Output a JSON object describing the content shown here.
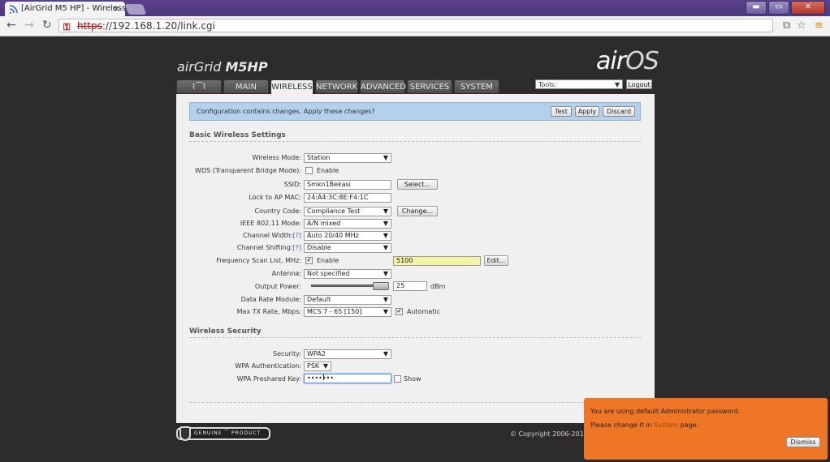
{
  "browser": {
    "tab_title": "[AirGrid M5 HP] - Wireless",
    "tab_close": "×",
    "url_scheme": "https",
    "url_rest": "://192.168.1.20/link.cgi",
    "win_min": "▬",
    "win_restore": "▭",
    "win_close": "✕"
  },
  "branding": {
    "product_prefix": "air",
    "product_name": "Grid",
    "product_model": "M5HP",
    "os_air": "air",
    "os_name": "OS"
  },
  "tabs": {
    "logo": "⌇⁀⌇",
    "main": "MAIN",
    "wireless": "WIRELESS",
    "network": "NETWORK",
    "advanced": "ADVANCED",
    "services": "SERVICES",
    "system": "SYSTEM"
  },
  "header": {
    "tools_value": "Tools:",
    "logout_label": "Logout"
  },
  "notice": {
    "text": "Configuration contains changes. Apply these changes?",
    "test_label": "Test",
    "apply_label": "Apply",
    "discard_label": "Discard"
  },
  "basic": {
    "section_title": "Basic Wireless Settings",
    "wireless_mode_label": "Wireless Mode:",
    "wireless_mode_value": "Station",
    "wds_label": "WDS (Transparent Bridge Mode):",
    "wds_checkbox_label": "Enable",
    "ssid_label": "SSID:",
    "ssid_value": "Smkn1Bekasi",
    "ssid_select_label": "Select...",
    "lock_ap_label": "Lock to AP MAC:",
    "lock_ap_value": "24:A4:3C:8E:F4:1C",
    "country_label": "Country Code:",
    "country_value": "Compliance Test",
    "country_change_label": "Change...",
    "ieee_label": "IEEE 802.11 Mode:",
    "ieee_value": "A/N mixed",
    "channel_width_label": "Channel Width:",
    "channel_width_value": "Auto 20/40 MHz",
    "channel_shift_label": "Channel Shifting:",
    "channel_shift_value": "Disable",
    "help_mark": "[?]",
    "freq_label": "Frequency Scan List, MHz:",
    "freq_checkbox_label": "Enable",
    "freq_value": "5100",
    "freq_edit_label": "Edit...",
    "antenna_label": "Antenna:",
    "antenna_value": "Not specified",
    "output_power_label": "Output Power:",
    "output_power_value": "25",
    "output_power_unit": "dBm",
    "output_power_level": 1.0,
    "data_rate_label": "Data Rate Module:",
    "data_rate_value": "Default",
    "max_tx_label": "Max TX Rate, Mbps:",
    "max_tx_value": "MCS 7 - 65 [150]",
    "max_tx_auto_label": "Automatic"
  },
  "security": {
    "section_title": "Wireless Security",
    "security_label": "Security:",
    "security_value": "WPA2",
    "auth_label": "WPA Authentication:",
    "auth_value": "PSK",
    "key_label": "WPA Preshared Key:",
    "key_value": "•••••••",
    "show_label": "Show"
  },
  "footer": {
    "genuine_text": "GENUINE ⁀ PRODUCT",
    "copyright": "© Copyright 2006-2013"
  },
  "toast": {
    "line1": "You are using default Administrator password.",
    "line2_before": "Please change it in ",
    "line2_link": "System",
    "line2_after": " page.",
    "dismiss_label": "Dismiss"
  },
  "colors": {
    "titlebar": "#5a3f8c",
    "notice_bg": "#b3d0ec",
    "toast_bg": "#ef7625",
    "highlight_input": "#f4f3a3"
  }
}
